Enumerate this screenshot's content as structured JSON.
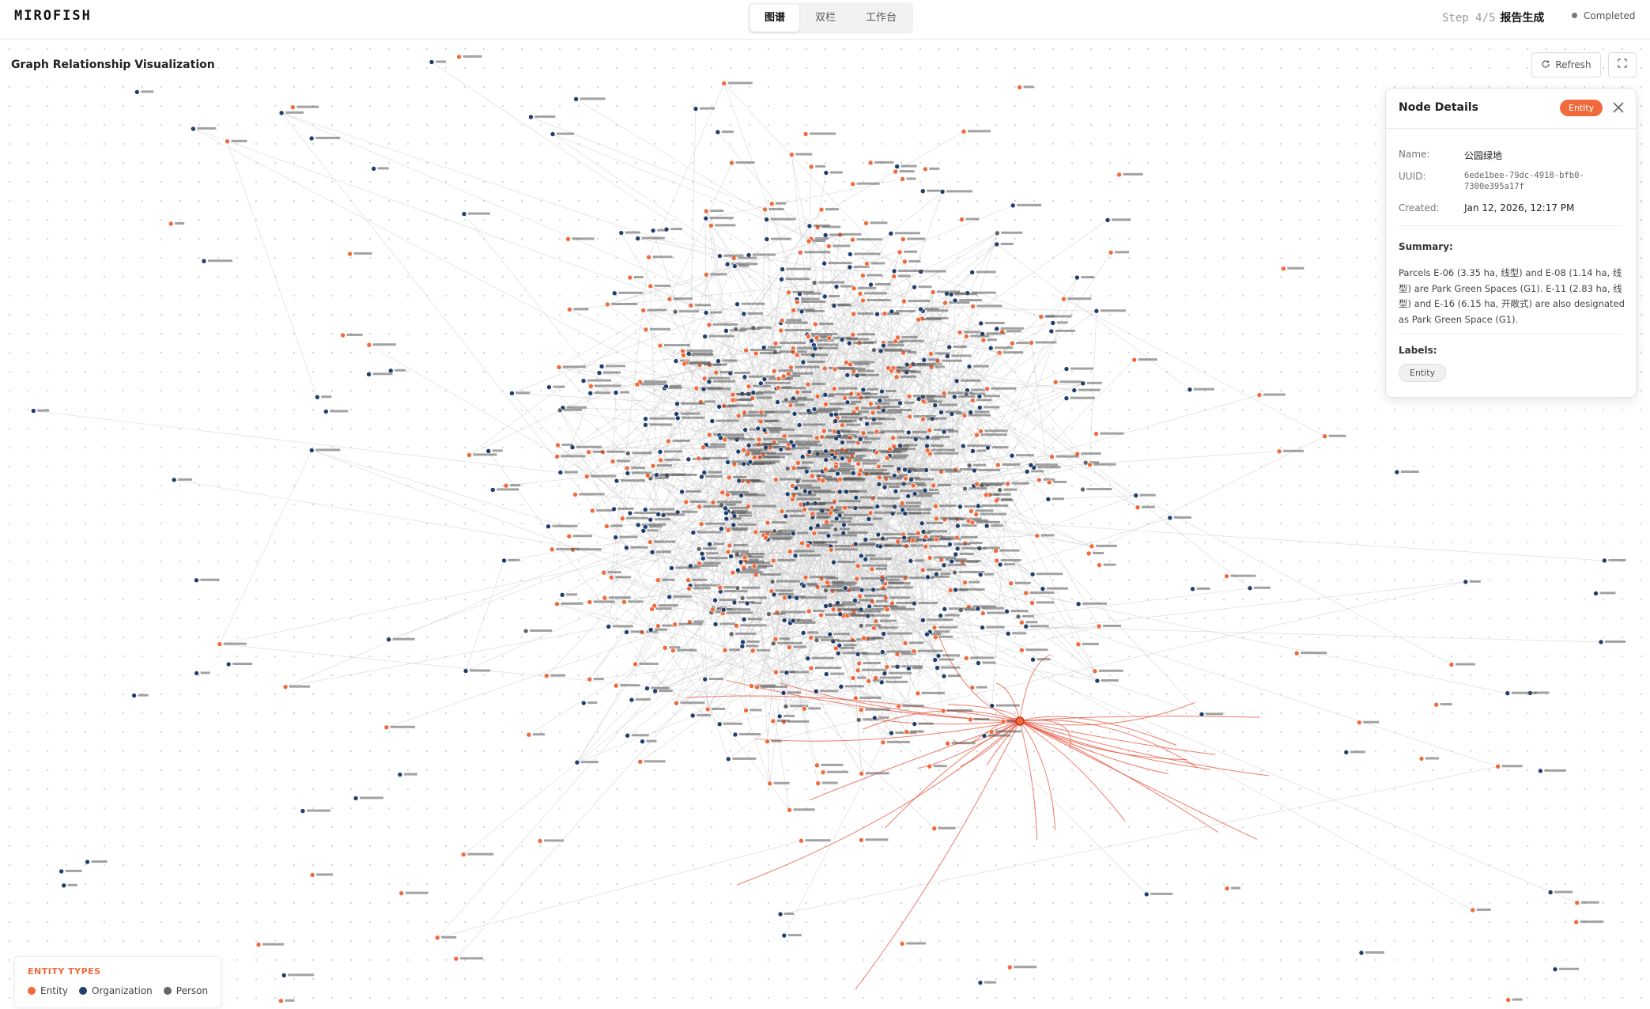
{
  "app": {
    "logo": "MIROFISH"
  },
  "header": {
    "tabs": [
      {
        "label": "图谱",
        "active": true
      },
      {
        "label": "双栏",
        "active": false
      },
      {
        "label": "工作台",
        "active": false
      }
    ],
    "step_label": "Step 4/5",
    "step_title": "报告生成",
    "status": "Completed"
  },
  "graph": {
    "title": "Graph Relationship Visualization",
    "refresh_label": "Refresh"
  },
  "panel": {
    "title": "Node Details",
    "badge": "Entity",
    "name_label": "Name:",
    "name_value": "公园绿地",
    "uuid_label": "UUID:",
    "uuid_value": "6ede1bee-79dc-4918-bfb0-7300e395a17f",
    "created_label": "Created:",
    "created_value": "Jan 12, 2026, 12:17 PM",
    "summary_label": "Summary:",
    "summary_text": "Parcels E-06 (3.35 ha, 线型) and E-08 (1.14 ha, 线型) are Park Green Spaces (G1). E-11 (2.83 ha, 线型) and E-16 (6.15 ha, 开敞式) are also designated as Park Green Space (G1).",
    "labels_label": "Labels:",
    "label_chip": "Entity"
  },
  "legend": {
    "title": "ENTITY TYPES",
    "items": [
      {
        "label": "Entity",
        "color": "#f06a3c"
      },
      {
        "label": "Organization",
        "color": "#1f3f6e"
      },
      {
        "label": "Person",
        "color": "#666666"
      }
    ]
  },
  "colors": {
    "accent": "#f06a3c",
    "organization": "#1f3f6e",
    "person": "#666666",
    "edge": "#cfcfcf",
    "highlight_edge": "#e8503a"
  }
}
